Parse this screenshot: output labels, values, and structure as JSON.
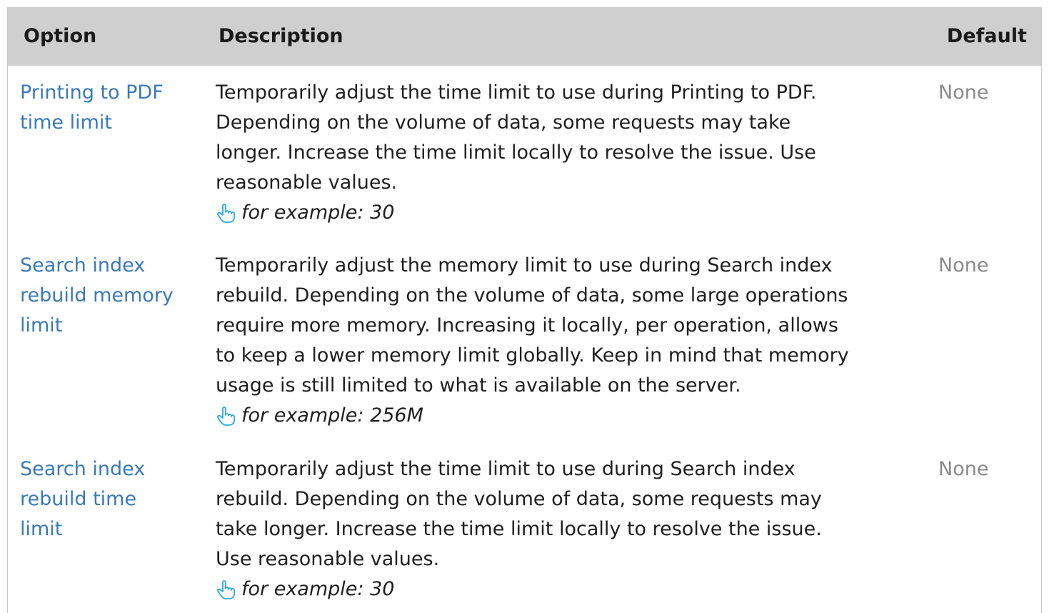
{
  "table": {
    "headers": {
      "option": "Option",
      "description": "Description",
      "default": "Default"
    },
    "rows": [
      {
        "option_lines": [
          "Printing to PDF",
          "time limit"
        ],
        "description_lines": [
          "Temporarily adjust the time limit to use during Printing to PDF.",
          "Depending on the volume of data, some requests may take",
          "longer. Increase the time limit locally to resolve the issue. Use",
          "reasonable values."
        ],
        "example": "for example: 30",
        "default": "None"
      },
      {
        "option_lines": [
          "Search index",
          "rebuild memory",
          "limit"
        ],
        "description_lines": [
          "Temporarily adjust the memory limit to use during Search index",
          "rebuild. Depending on the volume of data, some large operations",
          "require more memory. Increasing it locally, per operation, allows",
          "to keep a lower memory limit globally. Keep in mind that memory",
          "usage is still limited to what is available on the server."
        ],
        "example": "for example: 256M",
        "default": "None"
      },
      {
        "option_lines": [
          "Search index",
          "rebuild time",
          "limit"
        ],
        "description_lines": [
          "Temporarily adjust the time limit to use during Search index",
          "rebuild. Depending on the volume of data, some requests may",
          "take longer. Increase the time limit locally to resolve the issue.",
          "Use reasonable values."
        ],
        "example": "for example: 30",
        "default": "None"
      }
    ],
    "colors": {
      "header_bg": "#cfcfcf",
      "link": "#3a7ab8",
      "default_text": "#8a8a8a",
      "hand_icon": "#29a8e0"
    },
    "example_icon": "pointing-hand-icon"
  }
}
